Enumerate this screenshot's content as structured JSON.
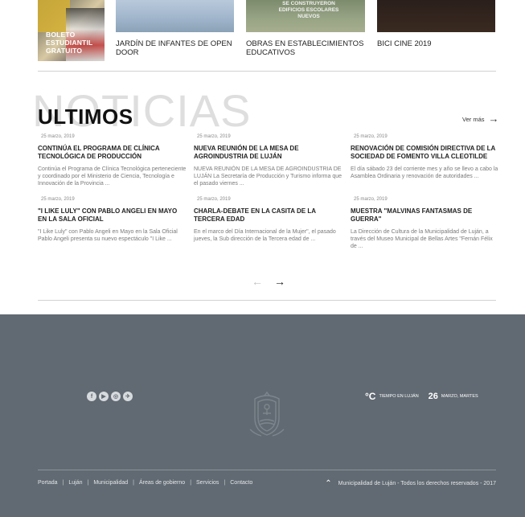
{
  "top_cards": [
    {
      "title": "",
      "overlay": "BOLETO ESTUDIANTIL GRATUITO"
    },
    {
      "title": "JARDÍN DE INFANTES DE OPEN DOOR"
    },
    {
      "title": "OBRAS EN ESTABLECIMIENTOS EDUCATIVOS",
      "image_caption": "SE CONSTRUYERON EDIFICIOS ESCOLARES NUEVOS"
    },
    {
      "title": "BICI CINE 2019"
    }
  ],
  "news_section": {
    "bg_word": "NOTICIAS",
    "heading": "ULTIMOS",
    "ver_mas": "Ver más",
    "items": [
      {
        "date": "25 marzo, 2019",
        "title": "CONTINÚA EL PROGRAMA DE CLÍNICA TECNOLÓGICA DE PRODUCCIÓN",
        "body": "Continúa  el Programa de Clínica Tecnológica perteneciente y coordinado por el  Ministerio de Ciencia, Tecnología e Innovación de la Provincia ..."
      },
      {
        "date": "25 marzo, 2019",
        "title": "NUEVA REUNIÓN DE LA MESA DE AGROINDUSTRIA DE LUJÁN",
        "body": "NUEVA REUNIÓN DE LA MESA DE AGROINDUSTRIA DE LUJÁN La Secretaría de Producción y Turismo informa que el pasado viernes ..."
      },
      {
        "date": "25 marzo, 2019",
        "title": "RENOVACIÓN DE COMISIÓN DIRECTIVA DE LA SOCIEDAD DE FOMENTO VILLA CLEOTILDE",
        "body": "El día sábado 23 del corriente mes y año se llevo a cabo la  Asamblea Ordinaria y renovación de autoridades ..."
      },
      {
        "date": "25 marzo, 2019",
        "title": "\"I LIKE LULY\" CON PABLO ANGELI EN MAYO EN LA SALA OFICIAL",
        "body": "\"I Like Luly\" con Pablo Angeli en Mayo en la Sala Oficial Pablo Angeli presenta su nuevo espectáculo \"I Like ..."
      },
      {
        "date": "25 marzo, 2019",
        "title": "CHARLA-DEBATE EN LA CASITA DE LA TERCERA EDAD",
        "body": "En el marco del Día Internacional de la Mujer\", el pasado jueves, la Sub dirección de la Tercera edad de ..."
      },
      {
        "date": "25 marzo, 2019",
        "title": "MUESTRA \"MALVINAS FANTASMAS DE GUERRA\"",
        "body": "La Dirección de Cultura de la Municipalidad de Luján, a través del Museo Municipal de Bellas Artes \"Fernán Félix de ..."
      }
    ]
  },
  "pager": {
    "prev": "←",
    "next": "→"
  },
  "footer": {
    "social": [
      "f",
      "▶",
      "◎",
      "✈"
    ],
    "weather_unit": "°C",
    "weather_label": "TIEMPO EN LUJÁN",
    "day": "26",
    "date_label": "MARZO, MARTES",
    "nav": [
      "Portada",
      "Luján",
      "Municipalidad",
      "Áreas de gobierno",
      "Servicios",
      "Contacto"
    ],
    "copyright": "Municipalidad de Luján - Todos los derechos reservados - 2017"
  }
}
